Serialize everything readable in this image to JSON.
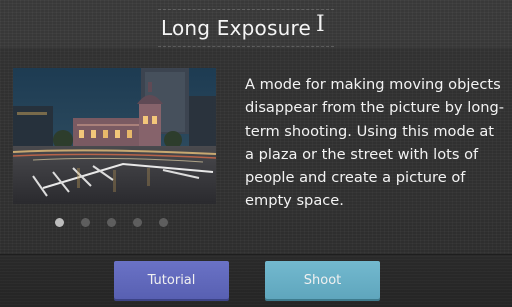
{
  "header": {
    "title": "Long Exposure",
    "cursor_glyph": "I"
  },
  "mode_info": {
    "description": "A mode for making moving objects disappear from the picture by long-term shooting. Using this mode at a plaza or the street with lots of people and create a picture of empty space.",
    "image_icon": "long-exposure-sample-photo"
  },
  "pager": {
    "page_count": 5,
    "current_page": 1
  },
  "actions": {
    "tutorial_label": "Tutorial",
    "shoot_label": "Shoot"
  },
  "colors": {
    "tutorial_button": "#5f67bb",
    "shoot_button": "#68afc6",
    "background": "#383838",
    "text": "#f3f3f3"
  }
}
